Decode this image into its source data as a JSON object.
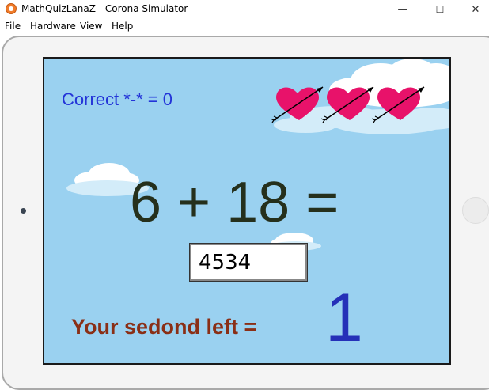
{
  "window": {
    "title": "MathQuizLanaZ - Corona Simulator",
    "minimize": "—",
    "maximize": "☐",
    "close": "✕"
  },
  "menu": [
    "File",
    "Hardware",
    "View",
    "Help"
  ],
  "game": {
    "score_label": "Correct *-* = 0",
    "equation": "6 + 18 =",
    "answer_value": "4534",
    "seconds_label": "Your sedond left =",
    "seconds_value": "1",
    "lives": 3
  },
  "colors": {
    "sky": "#9ad1f0",
    "score_text": "#2333d8",
    "equation_text": "#25301c",
    "seconds_label": "#8a2f16",
    "seconds_value": "#2530b8",
    "heart": "#e8126a"
  }
}
